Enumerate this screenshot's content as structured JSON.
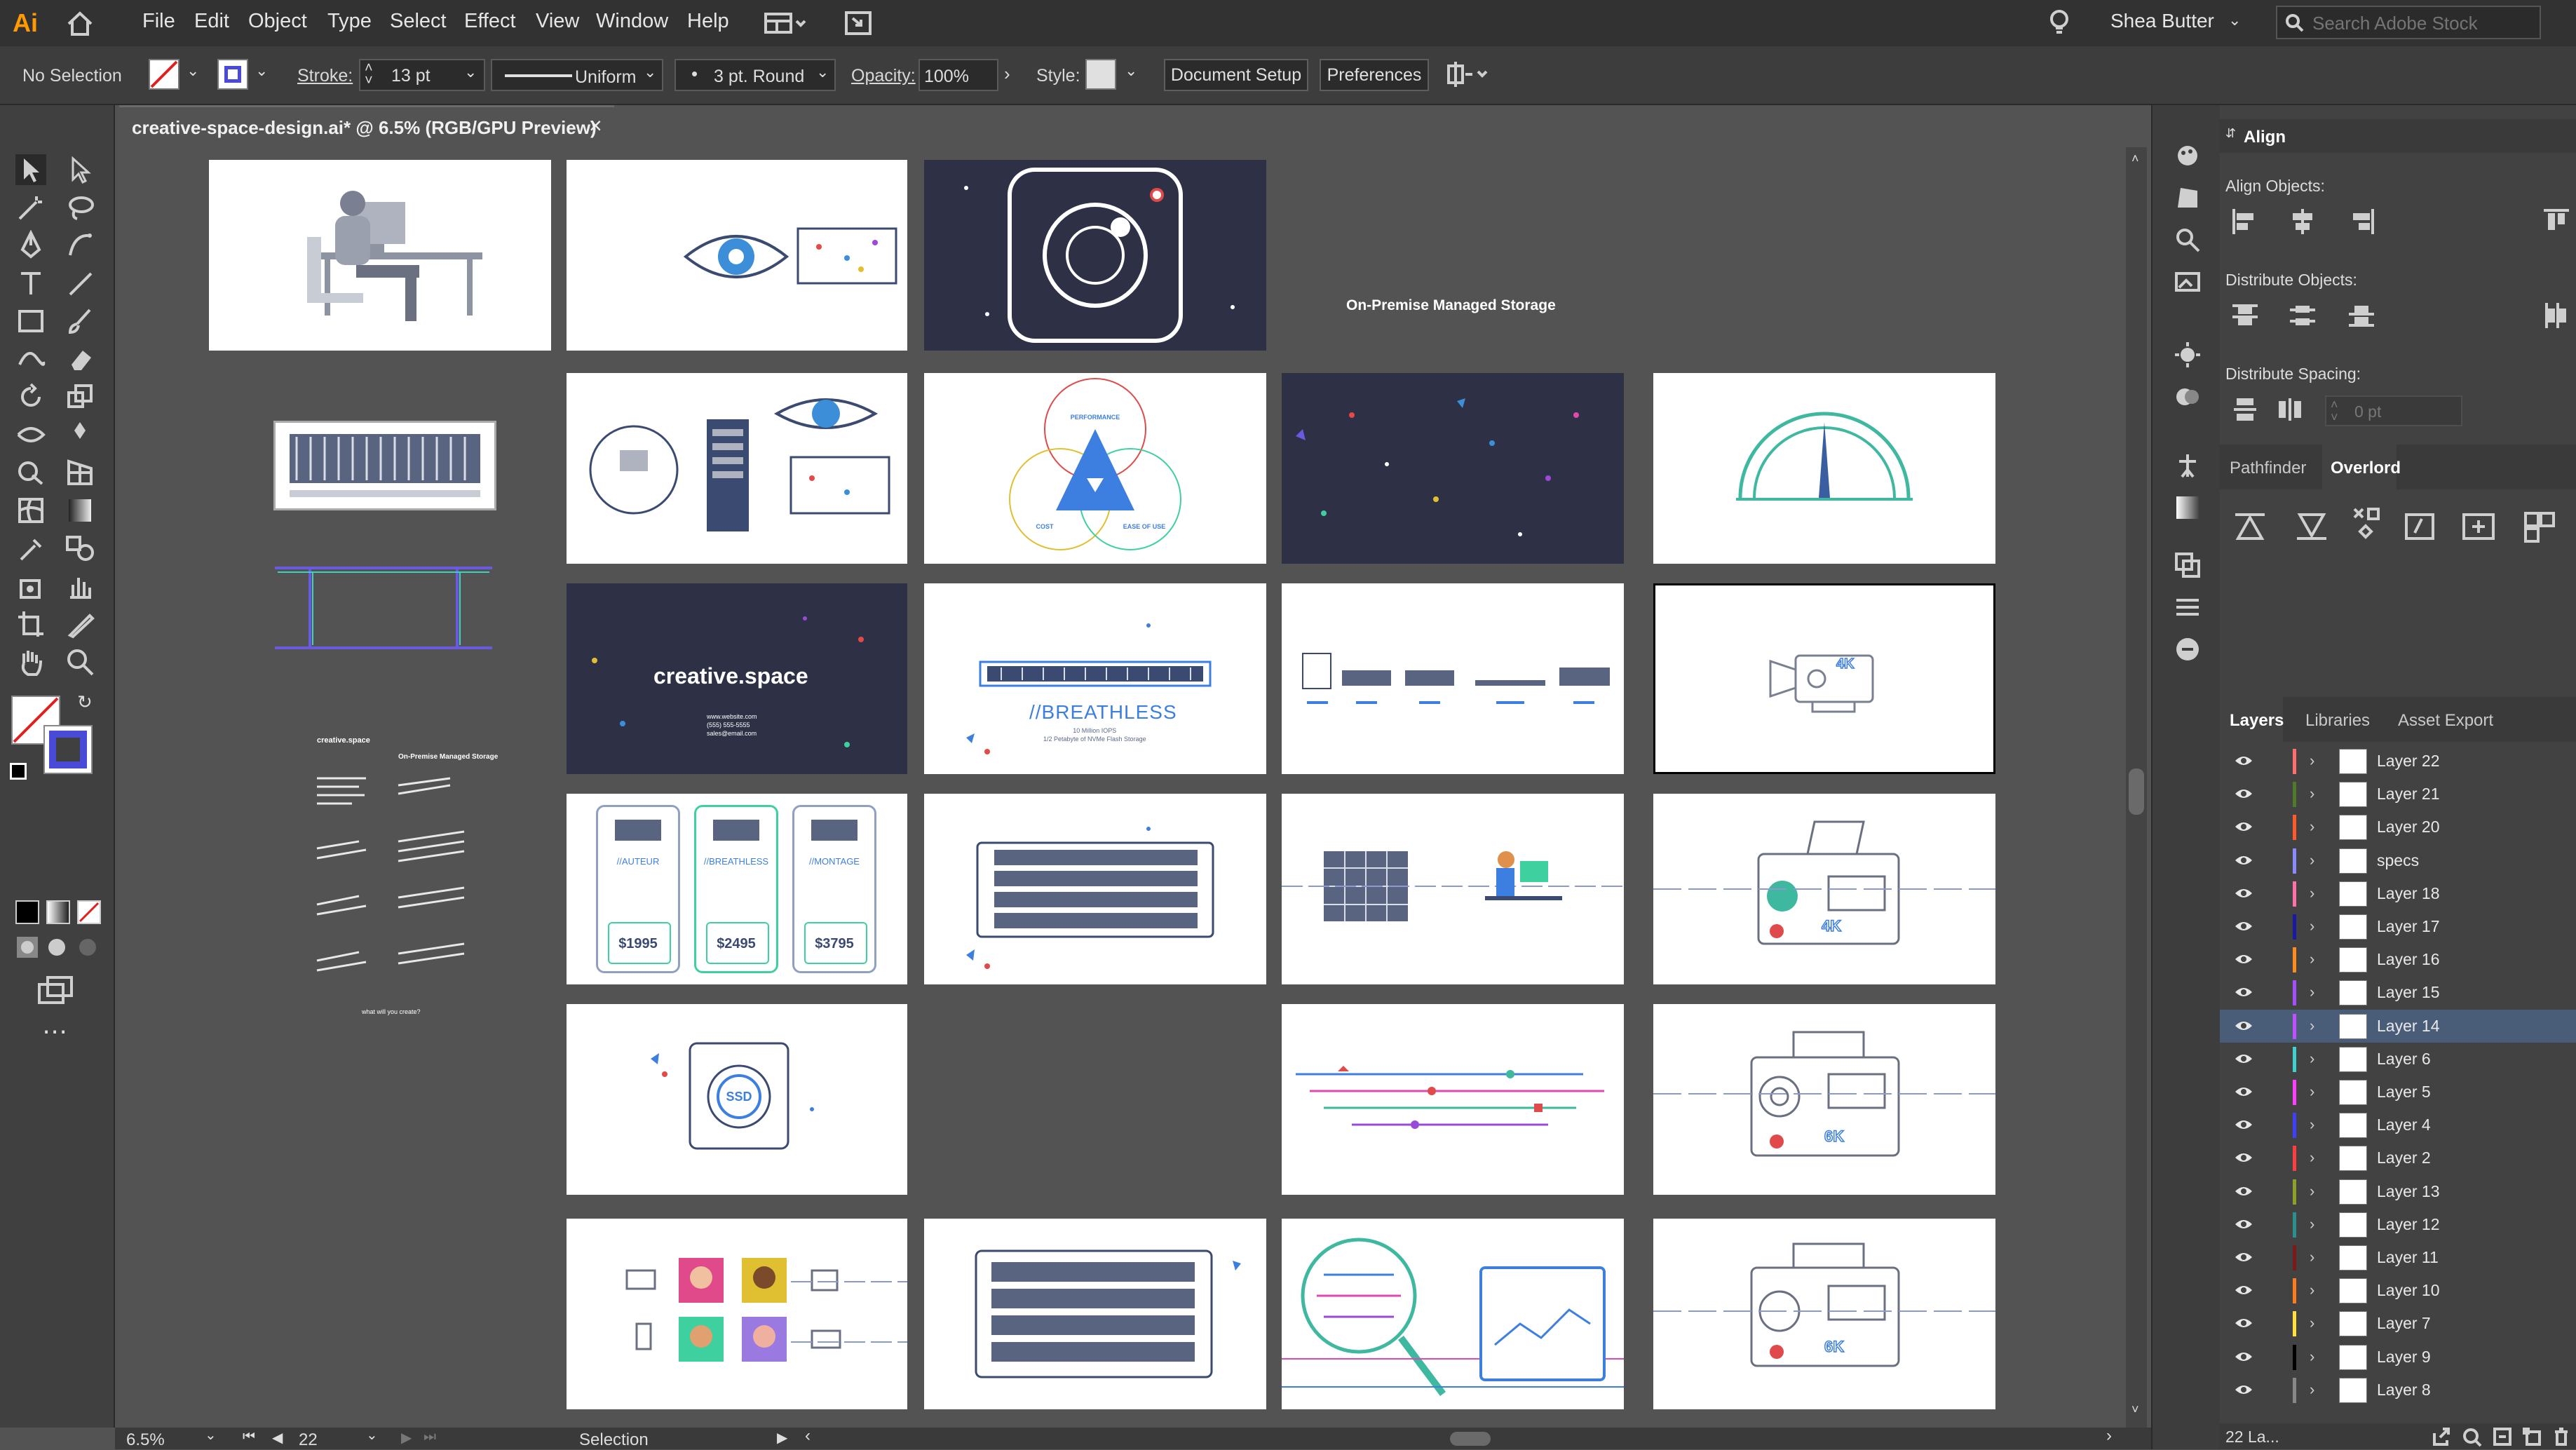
{
  "app": {
    "logo": "Ai",
    "accent": "#ff9a00"
  },
  "menu": [
    "File",
    "Edit",
    "Object",
    "Type",
    "Select",
    "Effect",
    "View",
    "Window",
    "Help"
  ],
  "user": {
    "name": "Shea Butter"
  },
  "search": {
    "placeholder": "Search Adobe Stock"
  },
  "control": {
    "selection": "No Selection",
    "stroke_label": "Stroke:",
    "stroke_value": "13 pt",
    "profile": "Uniform",
    "brush": "3 pt. Round",
    "opacity_label": "Opacity:",
    "opacity_value": "100%",
    "style_label": "Style:",
    "document_setup": "Document Setup",
    "preferences": "Preferences"
  },
  "document": {
    "tab_title": "creative-space-design.ai* @ 6.5% (RGB/GPU Preview)",
    "close": "×"
  },
  "canvas": {
    "heading": "On-Premise Managed Storage",
    "logo_text": "creative.space",
    "logo_sub": "www.website.com\n(555) 555-5555\nsales@email.com",
    "venn": {
      "top": "PERFORMANCE",
      "left": "COST",
      "right": "EASE OF USE"
    },
    "breathless": "//BREATHLESS",
    "breathless_sub": "10 Million IOPS\n1/2 Petabyte of NVMe Flash Storage",
    "badge_4k": "4K",
    "badge_6k": "6K",
    "ssd": "SSD",
    "plans": [
      {
        "name": "//AUTEUR",
        "price": "$1995"
      },
      {
        "name": "//BREATHLESS",
        "price": "$2495"
      },
      {
        "name": "//MONTAGE",
        "price": "$3795"
      }
    ],
    "spec_sheet_title": "creative.space",
    "spec_sheet_heading": "On-Premise Managed Storage",
    "spec_footer": "what will you create?"
  },
  "status": {
    "zoom": "6.5%",
    "artboard": "22",
    "mode": "Selection"
  },
  "panels": {
    "align_title": "Align",
    "align_objects": "Align Objects:",
    "distribute_objects": "Distribute Objects:",
    "distribute_spacing": "Distribute Spacing:",
    "spacing_value": "0 pt",
    "pf_tabs": [
      "Pathfinder",
      "Overlord"
    ],
    "layer_tabs": [
      "Layers",
      "Libraries",
      "Asset Export"
    ],
    "layers_footer": "22 La..."
  },
  "layers": [
    {
      "name": "Layer 22",
      "color": "#ff6f6f"
    },
    {
      "name": "Layer 21",
      "color": "#4f7a2a"
    },
    {
      "name": "Layer 20",
      "color": "#ff5a2a"
    },
    {
      "name": "specs",
      "color": "#8a8aff"
    },
    {
      "name": "Layer 18",
      "color": "#ff6fa8"
    },
    {
      "name": "Layer 17",
      "color": "#1a1aa0"
    },
    {
      "name": "Layer 16",
      "color": "#ff8c1a"
    },
    {
      "name": "Layer 15",
      "color": "#a44fff"
    },
    {
      "name": "Layer 14",
      "color": "#c04fff",
      "selected": true
    },
    {
      "name": "Layer 6",
      "color": "#3fd0d0"
    },
    {
      "name": "Layer 5",
      "color": "#ff3fff"
    },
    {
      "name": "Layer 4",
      "color": "#3f3fff"
    },
    {
      "name": "Layer 2",
      "color": "#ff3f3f"
    },
    {
      "name": "Layer 13",
      "color": "#8fa02a"
    },
    {
      "name": "Layer 12",
      "color": "#2a8f8f"
    },
    {
      "name": "Layer 11",
      "color": "#7a1a1a"
    },
    {
      "name": "Layer 10",
      "color": "#ff7a1a"
    },
    {
      "name": "Layer 7",
      "color": "#ffe03f"
    },
    {
      "name": "Layer 9",
      "color": "#000000"
    },
    {
      "name": "Layer 8",
      "color": "#888888"
    }
  ]
}
